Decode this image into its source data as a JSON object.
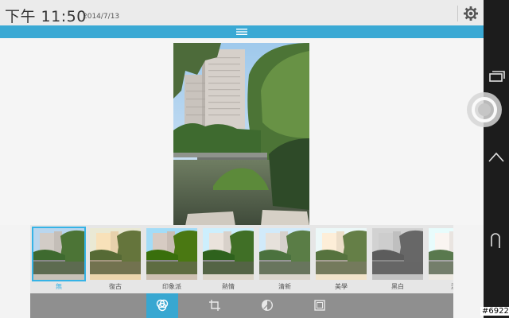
{
  "status": {
    "time": "下午 11:50",
    "date": "2014/7/13"
  },
  "icons": {
    "settings": "gear-icon",
    "menu": "menu-icon"
  },
  "filters": [
    {
      "label": "無",
      "selected": true
    },
    {
      "label": "復古",
      "selected": false
    },
    {
      "label": "印象派",
      "selected": false
    },
    {
      "label": "熱情",
      "selected": false
    },
    {
      "label": "清新",
      "selected": false
    },
    {
      "label": "美學",
      "selected": false
    },
    {
      "label": "黑白",
      "selected": false
    },
    {
      "label": "漂",
      "selected": false
    }
  ],
  "tools": [
    "filters-icon",
    "crop-icon",
    "adjust-icon",
    "frame-icon"
  ],
  "nav": [
    "recents-icon",
    "home-icon",
    "back-icon"
  ],
  "watermark": "#6922",
  "colors": {
    "accent": "#3aa9d4",
    "selected": "#36b3e6"
  }
}
